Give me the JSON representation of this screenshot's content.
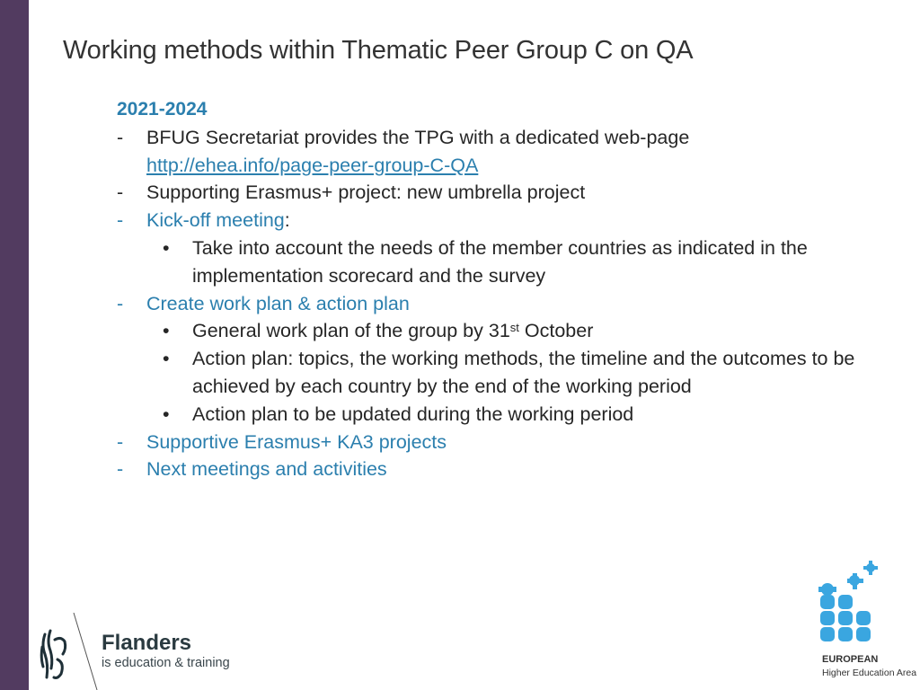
{
  "slide": {
    "title": "Working methods within Thematic Peer Group C on QA",
    "period": "2021-2024",
    "items": [
      {
        "marker": "-",
        "text": "BFUG Secretariat provides the TPG with a dedicated web-page",
        "link": "http://ehea.info/page-peer-group-C-QA"
      },
      {
        "marker": "-",
        "text": "Supporting Erasmus+ project: new umbrella project"
      },
      {
        "marker": "-",
        "text": "Kick-off meeting",
        "suffix": ":",
        "subitems": [
          {
            "marker": "•",
            "text": "Take into account the needs of the member countries as indicated in the implementation scorecard and the survey"
          }
        ]
      },
      {
        "marker": "-",
        "text": "Create work plan & action plan",
        "subitems": [
          {
            "marker": "•",
            "text_before": "General work plan of the group by 31",
            "sup": "st",
            "text_after": " October"
          },
          {
            "marker": "•",
            "text": "Action plan: topics, the working methods, the timeline and the outcomes to be achieved by each country by the end of the working period"
          },
          {
            "marker": "•",
            "text": "Action plan to be updated during the working period"
          }
        ]
      },
      {
        "marker": "-",
        "text": "Supportive Erasmus+ KA3 projects"
      },
      {
        "marker": "-",
        "text": "Next meetings and activities"
      }
    ]
  },
  "logos": {
    "flanders": {
      "name": "Flanders",
      "tagline": "is education & training"
    },
    "ehea": {
      "line1": "EUROPEAN",
      "line2": "Higher Education Area"
    }
  },
  "colors": {
    "sidebar": "#523b60",
    "accent": "#2b7fae",
    "ehea_blue": "#3aa6e0"
  }
}
